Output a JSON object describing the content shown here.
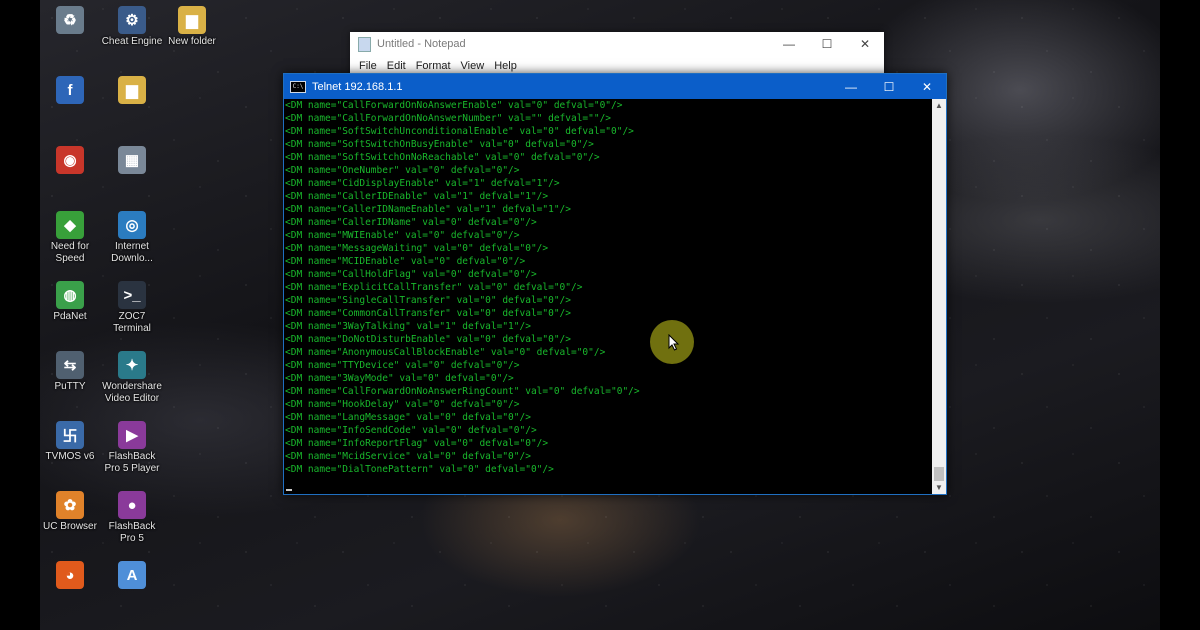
{
  "desktop": {
    "icons": [
      {
        "name": "recycle-bin-icon",
        "label": "",
        "glyph": "♻",
        "color": "#6a7c8c"
      },
      {
        "name": "cheat-engine-icon",
        "label": "Cheat Engine",
        "glyph": "⚙",
        "color": "#3a5b8a"
      },
      {
        "name": "new-folder-icon",
        "label": "New folder",
        "glyph": "▆",
        "color": "#d9b146"
      },
      {
        "name": "facebook-icon",
        "label": "",
        "glyph": "f",
        "color": "#2e66b8"
      },
      {
        "name": "folder-icon",
        "label": "",
        "glyph": "▆",
        "color": "#d9b146"
      },
      {
        "name": "app-icon-red",
        "label": "",
        "glyph": "◉",
        "color": "#c8362a"
      },
      {
        "name": "network-icon",
        "label": "",
        "glyph": "▦",
        "color": "#7a8898"
      },
      {
        "name": "need-for-speed-icon",
        "label": "Need for Speed",
        "glyph": "◆",
        "color": "#38a03a"
      },
      {
        "name": "internet-download-manager-icon",
        "label": "Internet Downlo...",
        "glyph": "◎",
        "color": "#2b7cc0"
      },
      {
        "name": "pdanet-icon",
        "label": "PdaNet",
        "glyph": "◍",
        "color": "#3aa04a"
      },
      {
        "name": "zoc-terminal-icon",
        "label": "ZOC7 Terminal",
        "glyph": ">_",
        "color": "#2a3340"
      },
      {
        "name": "putty-icon",
        "label": "PuTTY",
        "glyph": "⇆",
        "color": "#506070"
      },
      {
        "name": "wondershare-icon",
        "label": "Wondershare Video Editor",
        "glyph": "✦",
        "color": "#2a7a8a"
      },
      {
        "name": "tvmos-icon",
        "label": "TVMOS v6",
        "glyph": "卐",
        "color": "#3a6aa8"
      },
      {
        "name": "flashback-player-icon",
        "label": "FlashBack Pro 5 Player",
        "glyph": "▶",
        "color": "#8a3a9a"
      },
      {
        "name": "uc-browser-icon",
        "label": "UC Browser",
        "glyph": "✿",
        "color": "#e0822a"
      },
      {
        "name": "flashback-recorder-icon",
        "label": "FlashBack Pro 5",
        "glyph": "●",
        "color": "#8a3a9a"
      },
      {
        "name": "firefox-icon",
        "label": "",
        "glyph": "◕",
        "color": "#e05a1c"
      },
      {
        "name": "text-app-icon",
        "label": "",
        "glyph": "A",
        "color": "#4f8fd8"
      }
    ]
  },
  "notepad": {
    "title": "Untitled - Notepad",
    "menu": [
      "File",
      "Edit",
      "Format",
      "View",
      "Help"
    ],
    "controls": [
      "—",
      "☐",
      "✕"
    ]
  },
  "telnet": {
    "title": "Telnet 192.168.1.1",
    "controls": [
      "—",
      "☐",
      "✕"
    ],
    "lines": [
      "<DM name=\"CallForwardOnNoAnswerEnable\" val=\"0\" defval=\"0\"/>",
      "<DM name=\"CallForwardOnNoAnswerNumber\" val=\"\" defval=\"\"/>",
      "<DM name=\"SoftSwitchUnconditionalEnable\" val=\"0\" defval=\"0\"/>",
      "<DM name=\"SoftSwitchOnBusyEnable\" val=\"0\" defval=\"0\"/>",
      "<DM name=\"SoftSwitchOnNoReachable\" val=\"0\" defval=\"0\"/>",
      "<DM name=\"OneNumber\" val=\"0\" defval=\"0\"/>",
      "<DM name=\"CidDisplayEnable\" val=\"1\" defval=\"1\"/>",
      "<DM name=\"CallerIDEnable\" val=\"1\" defval=\"1\"/>",
      "<DM name=\"CallerIDNameEnable\" val=\"1\" defval=\"1\"/>",
      "<DM name=\"CallerIDName\" val=\"0\" defval=\"0\"/>",
      "<DM name=\"MWIEnable\" val=\"0\" defval=\"0\"/>",
      "<DM name=\"MessageWaiting\" val=\"0\" defval=\"0\"/>",
      "<DM name=\"MCIDEnable\" val=\"0\" defval=\"0\"/>",
      "<DM name=\"CallHoldFlag\" val=\"0\" defval=\"0\"/>",
      "<DM name=\"ExplicitCallTransfer\" val=\"0\" defval=\"0\"/>",
      "<DM name=\"SingleCallTransfer\" val=\"0\" defval=\"0\"/>",
      "<DM name=\"CommonCallTransfer\" val=\"0\" defval=\"0\"/>",
      "<DM name=\"3WayTalking\" val=\"1\" defval=\"1\"/>",
      "<DM name=\"DoNotDisturbEnable\" val=\"0\" defval=\"0\"/>",
      "<DM name=\"AnonymousCallBlockEnable\" val=\"0\" defval=\"0\"/>",
      "<DM name=\"TTYDevice\" val=\"0\" defval=\"0\"/>",
      "<DM name=\"3WayMode\" val=\"0\" defval=\"0\"/>",
      "<DM name=\"CallForwardOnNoAnswerRingCount\" val=\"0\" defval=\"0\"/>",
      "<DM name=\"HookDelay\" val=\"0\" defval=\"0\"/>",
      "<DM name=\"LangMessage\" val=\"0\" defval=\"0\"/>",
      "<DM name=\"InfoSendCode\" val=\"0\" defval=\"0\"/>",
      "<DM name=\"InfoReportFlag\" val=\"0\" defval=\"0\"/>",
      "<DM name=\"McidService\" val=\"0\" defval=\"0\"/>",
      "<DM name=\"DialTonePattern\" val=\"0\" defval=\"0\"/>"
    ]
  },
  "colors": {
    "terminal_text": "#19b82c",
    "titlebar": "#0b5ec9"
  }
}
